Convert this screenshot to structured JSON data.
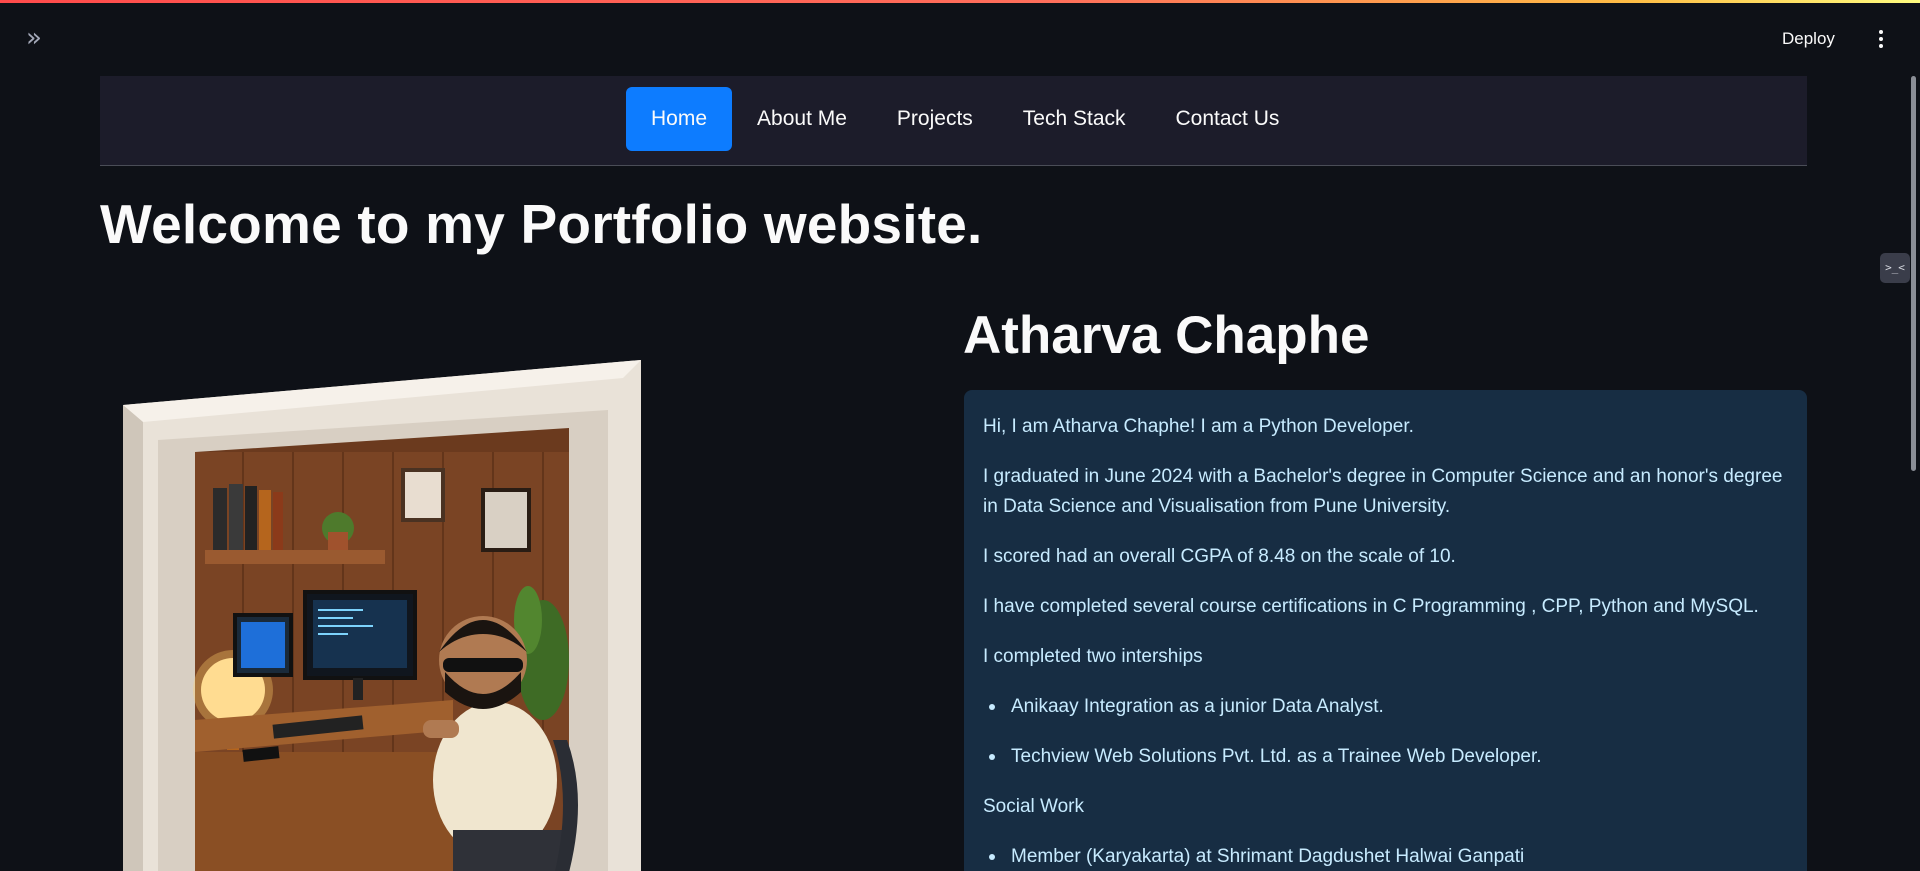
{
  "app": {
    "deploy_label": "Deploy",
    "expand_icon": "»",
    "dev_badge": ">_<"
  },
  "nav": {
    "items": [
      {
        "label": "Home",
        "active": true
      },
      {
        "label": "About Me",
        "active": false
      },
      {
        "label": "Projects",
        "active": false
      },
      {
        "label": "Tech Stack",
        "active": false
      },
      {
        "label": "Contact Us",
        "active": false
      }
    ]
  },
  "page": {
    "title": "Welcome to my Portfolio website.",
    "name": "Atharva Chaphe"
  },
  "bio": {
    "intro": "Hi, I am Atharva Chaphe! I am a Python Developer.",
    "education": "I graduated in June 2024 with a Bachelor's degree in Computer Science and an honor's degree in Data Science and Visualisation from Pune University.",
    "cgpa": "I scored had an overall CGPA of 8.48 on the scale of 10.",
    "certifications": "I have completed several course certifications in C Programming , CPP, Python and MySQL.",
    "internships_heading": "I completed two interships",
    "internships": [
      "Anikaay Integration as a junior Data Analyst.",
      "Techview Web Solutions Pvt. Ltd. as a Trainee Web Developer."
    ],
    "social_heading": "Social Work",
    "social": [
      "Member (Karyakarta) at Shrimant Dagdushet Halwai Ganpati"
    ]
  },
  "colors": {
    "background": "#0e1117",
    "navbar": "#1c1c2a",
    "active_tab": "#0d7cff",
    "card": "#172d43",
    "card_text": "#c7ebff"
  }
}
